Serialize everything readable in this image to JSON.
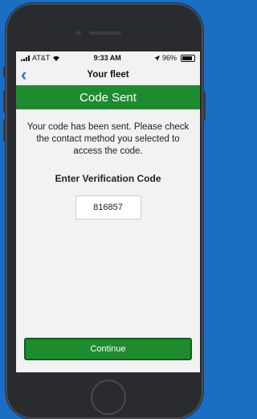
{
  "status_bar": {
    "carrier": "AT&T",
    "time": "9:33 AM",
    "battery": "96%"
  },
  "nav": {
    "back_label": "‹",
    "title": "Your fleet"
  },
  "banner": {
    "title": "Code Sent"
  },
  "content": {
    "message": "Your code has been sent. Please check the contact method you selected to access the code.",
    "heading": "Enter Verification Code",
    "code_value": "816857"
  },
  "actions": {
    "continue_label": "Continue"
  },
  "colors": {
    "accent_green": "#1e8c2e",
    "link_blue": "#2b6ed9",
    "background_blue": "#1a6fc4"
  }
}
